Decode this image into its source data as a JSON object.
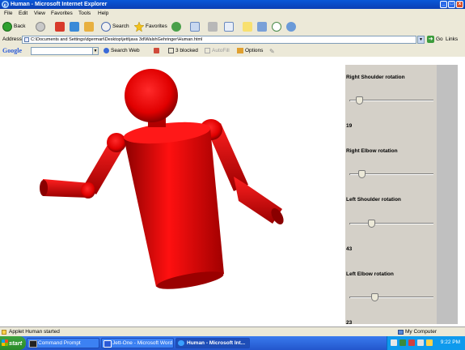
{
  "window": {
    "title": "Human - Microsoft Internet Explorer",
    "controls": {
      "minimize": "_",
      "maximize": "□",
      "close": "x"
    }
  },
  "menu": [
    "File",
    "Edit",
    "View",
    "Favorites",
    "Tools",
    "Help"
  ],
  "toolbar": {
    "back": "Back",
    "search": "Search",
    "favorites": "Favorites"
  },
  "address": {
    "label": "Address",
    "value": "C:\\Documents and Settings\\dgermari\\Desktop\\jett\\java 3d\\WalshGehringer\\Human.html",
    "go": "Go",
    "links": "Links"
  },
  "google": {
    "logo": "Google",
    "search_web": "Search Web",
    "blocked": "3 blocked",
    "autofill": "AutoFill",
    "options": "Options"
  },
  "panel": {
    "sliders": [
      {
        "label": "Right Shoulder rotation",
        "position": 0.08,
        "value": "19"
      },
      {
        "label": "Right Elbow rotation",
        "position": 0.12,
        "value": ""
      },
      {
        "label": "Left Shoulder rotation",
        "position": 0.24,
        "value": "43"
      },
      {
        "label": "Left Elbow rotation",
        "position": 0.28,
        "value": "23"
      }
    ]
  },
  "figure": {
    "color": "#e00000"
  },
  "status": {
    "text": "Applet Human started",
    "zone": "My Computer"
  },
  "taskbar": {
    "start": "start",
    "tasks": [
      {
        "label": "Command Prompt",
        "active": false
      },
      {
        "label": "Jett-One - Microsoft Word",
        "active": false
      },
      {
        "label": "Human - Microsoft Int...",
        "active": true
      }
    ],
    "clock": "9:22 PM"
  }
}
